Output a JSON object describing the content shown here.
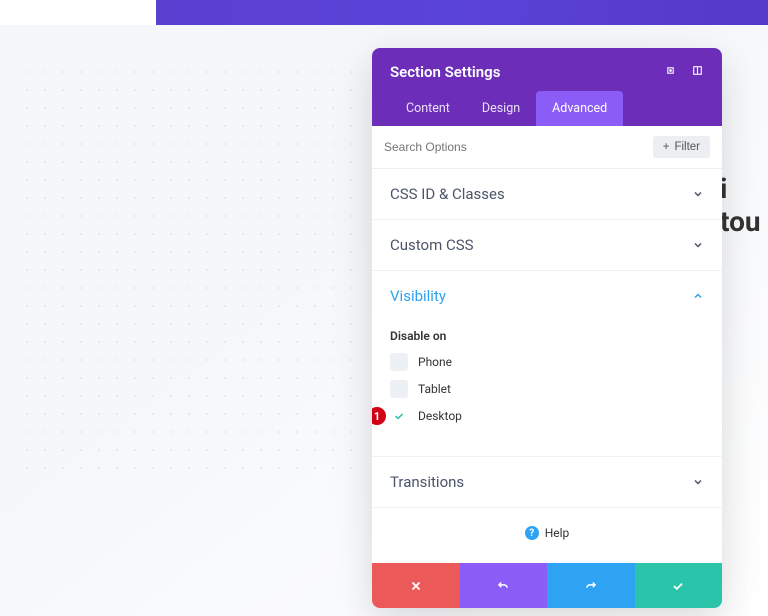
{
  "modal": {
    "title": "Section Settings",
    "tabs": [
      {
        "label": "Content",
        "active": false
      },
      {
        "label": "Design",
        "active": false
      },
      {
        "label": "Advanced",
        "active": true
      }
    ],
    "search_placeholder": "Search Options",
    "filter_label": "Filter"
  },
  "sections": {
    "css_id": {
      "title": "CSS ID & Classes"
    },
    "custom_css": {
      "title": "Custom CSS"
    },
    "visibility": {
      "title": "Visibility",
      "field_label": "Disable on",
      "options": {
        "phone": {
          "label": "Phone",
          "checked": false
        },
        "tablet": {
          "label": "Tablet",
          "checked": false
        },
        "desktop": {
          "label": "Desktop",
          "checked": true
        }
      }
    },
    "transitions": {
      "title": "Transitions"
    }
  },
  "help": {
    "label": "Help"
  },
  "annotation": {
    "number": "1"
  },
  "background_text": "i tou"
}
